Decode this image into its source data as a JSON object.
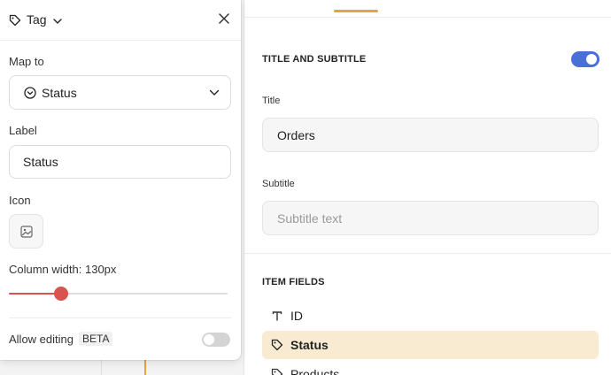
{
  "popover": {
    "type_label": "Tag",
    "map_to_label": "Map to",
    "map_to_value": "Status",
    "label_label": "Label",
    "label_value": "Status",
    "icon_label": "Icon",
    "column_width_label": "Column width: 130px",
    "column_width_fraction": 0.24,
    "allow_editing_label": "Allow editing",
    "beta_badge": "BETA",
    "allow_editing_enabled": false
  },
  "right_panel": {
    "title_section": {
      "heading": "TITLE AND SUBTITLE",
      "enabled": true,
      "title_label": "Title",
      "title_value": "Orders",
      "subtitle_label": "Subtitle",
      "subtitle_placeholder": "Subtitle text"
    },
    "item_fields": {
      "heading": "ITEM FIELDS",
      "items": [
        {
          "label": "ID",
          "icon": "text-icon",
          "selected": false
        },
        {
          "label": "Status",
          "icon": "tag-icon",
          "selected": true
        },
        {
          "label": "Products",
          "icon": "tag-icon",
          "selected": false
        }
      ]
    }
  },
  "colors": {
    "accent_orange": "#e8a33d",
    "toggle_blue": "#4a6fd6",
    "slider_red": "#d9534f",
    "selected_row_bg": "#f8ebd2"
  }
}
